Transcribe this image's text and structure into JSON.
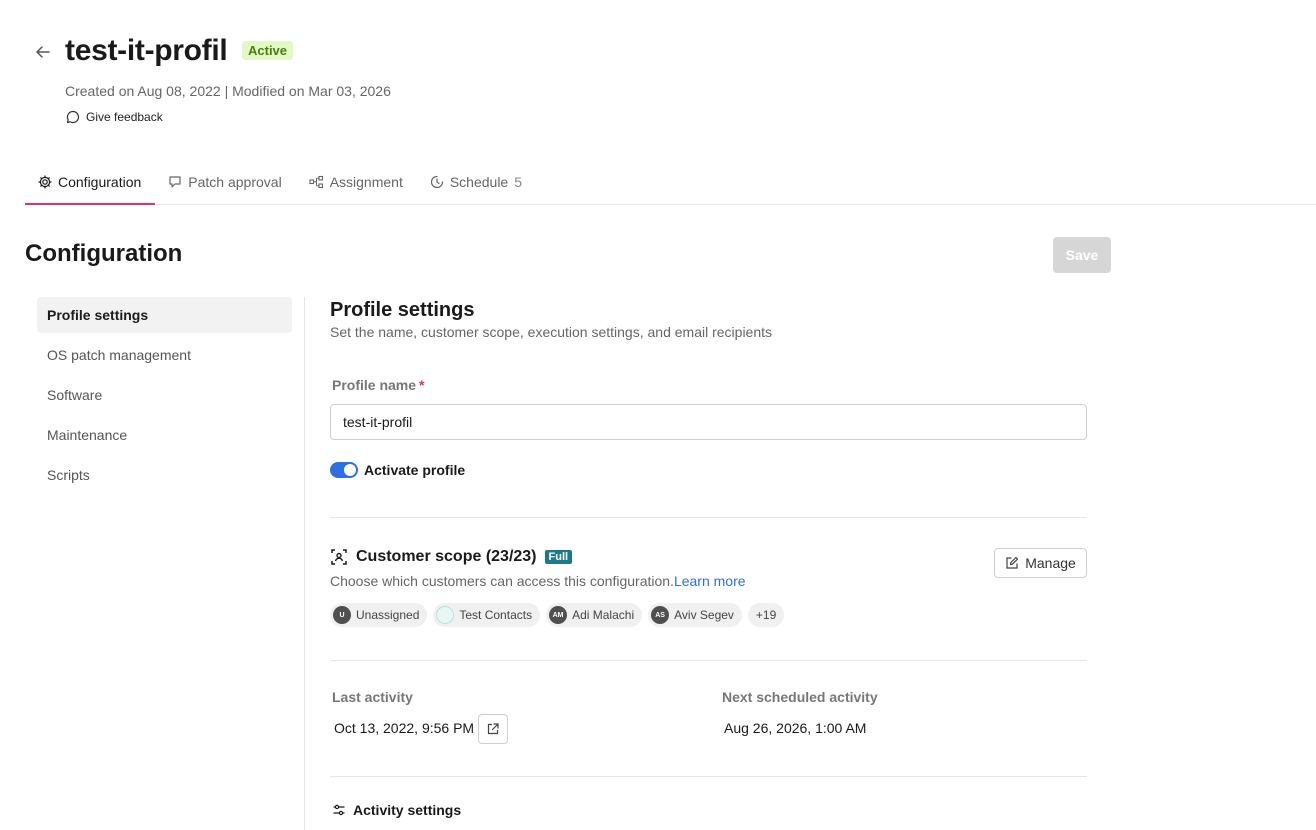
{
  "header": {
    "title": "test-it-profil",
    "status": "Active",
    "meta": "Created on Aug 08, 2022 | Modified on Mar 03, 2026",
    "feedback_label": "Give feedback"
  },
  "tabs": [
    {
      "label": "Configuration",
      "icon": "gear-icon",
      "active": true
    },
    {
      "label": "Patch approval",
      "icon": "approval-icon",
      "active": false
    },
    {
      "label": "Assignment",
      "icon": "hierarchy-icon",
      "active": false
    },
    {
      "label": "Schedule",
      "count": "5",
      "icon": "clock-icon",
      "active": false
    }
  ],
  "section": {
    "title": "Configuration",
    "save_label": "Save"
  },
  "sidebar": {
    "items": [
      {
        "label": "Profile settings",
        "active": true
      },
      {
        "label": "OS patch management",
        "active": false
      },
      {
        "label": "Software",
        "active": false
      },
      {
        "label": "Maintenance",
        "active": false
      },
      {
        "label": "Scripts",
        "active": false
      }
    ]
  },
  "profile": {
    "title": "Profile settings",
    "subtitle": "Set the name, customer scope, execution settings, and email recipients",
    "name_label": "Profile name",
    "required_mark": "*",
    "name_value": "test-it-profil",
    "activate_label": "Activate profile",
    "activate_on": true
  },
  "scope": {
    "title": "Customer scope (23/23)",
    "badge": "Full",
    "subtitle": "Choose which customers can access this configuration.",
    "learn_more": "Learn more",
    "manage_label": "Manage",
    "chips": [
      {
        "initials": "U",
        "label": "Unassigned",
        "style": "dark"
      },
      {
        "initials": "",
        "label": "Test Contacts",
        "style": "light"
      },
      {
        "initials": "AM",
        "label": "Adi Malachi",
        "style": "dark"
      },
      {
        "initials": "AS",
        "label": "Aviv Segev",
        "style": "dark"
      }
    ],
    "more": "+19"
  },
  "activity": {
    "last_label": "Last activity",
    "last_value": "Oct 13, 2022, 9:56 PM",
    "next_label": "Next scheduled activity",
    "next_value": "Aug 26, 2026, 1:00 AM",
    "settings_label": "Activity settings"
  },
  "colors": {
    "accent_tab": "#e0306f",
    "toggle_on": "#2f6fe0",
    "badge_active_bg": "#e4f7c7",
    "badge_full_bg": "#1d7a8c"
  }
}
